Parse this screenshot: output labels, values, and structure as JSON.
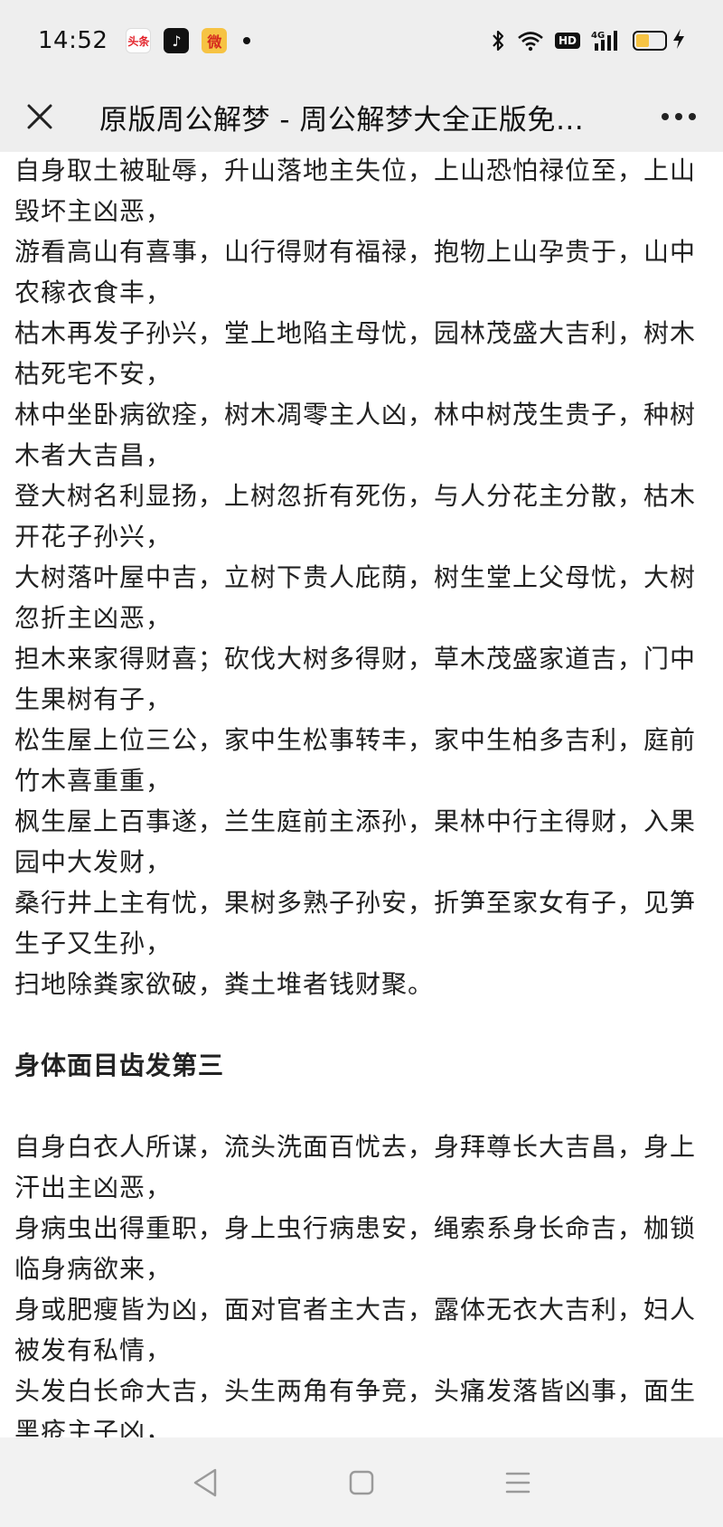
{
  "status_bar": {
    "time": "14:52",
    "apps": [
      {
        "name": "toutiao-icon",
        "label": "头条"
      },
      {
        "name": "douyin-icon",
        "label": "♪"
      },
      {
        "name": "weibo-icon",
        "label": "微"
      }
    ],
    "network": "4G",
    "hd": "HD",
    "battery_level": 0.45,
    "battery_color": "#f6c343"
  },
  "title_bar": {
    "title": "原版周公解梦 - 周公解梦大全正版免…",
    "close_glyph": "✕",
    "more_glyph": "•••"
  },
  "content": {
    "block1": [
      "自身取土被耻辱，升山落地主失位，上山恐怕禄位至，上山毁坏主凶恶，",
      "游看高山有喜事，山行得财有福禄，抱物上山孕贵于，山中农稼衣食丰，",
      "枯木再发子孙兴，堂上地陷主母忧，园林茂盛大吉利，树木枯死宅不安，",
      "林中坐卧病欲痊，树木凋零主人凶，林中树茂生贵子，种树木者大吉昌，",
      "登大树名利显扬，上树忽折有死伤，与人分花主分散，枯木开花子孙兴，",
      "大树落叶屋中吉，立树下贵人庇荫，树生堂上父母忧，大树忽折主凶恶，",
      "担木来家得财喜；砍伐大树多得财，草木茂盛家道吉，门中生果树有子，",
      "松生屋上位三公，家中生松事转丰，家中生柏多吉利，庭前竹木喜重重，",
      "枫生屋上百事遂，兰生庭前主添孙，果林中行主得财，入果园中大发财，",
      "桑行井上主有忧，果树多熟子孙安，折笋至家女有子，见笋生子又生孙，",
      "扫地除粪家欲破，粪土堆者钱财聚。"
    ],
    "section_heading": "身体面目齿发第三",
    "block2": [
      "自身白衣人所谋，流头洗面百忧去，身拜尊长大吉昌，身上汗出主凶恶，",
      "身病虫出得重职，身上虫行病患安，绳索系身长命吉，枷锁临身病欲来，",
      "身或肥瘦皆为凶，面对官者主大吉，露体无衣大吉利，妇人被发有私情，",
      "头发白长命大吉，头生两角有争竞，头痛发落皆凶事，面生黑疮主子凶，"
    ]
  }
}
